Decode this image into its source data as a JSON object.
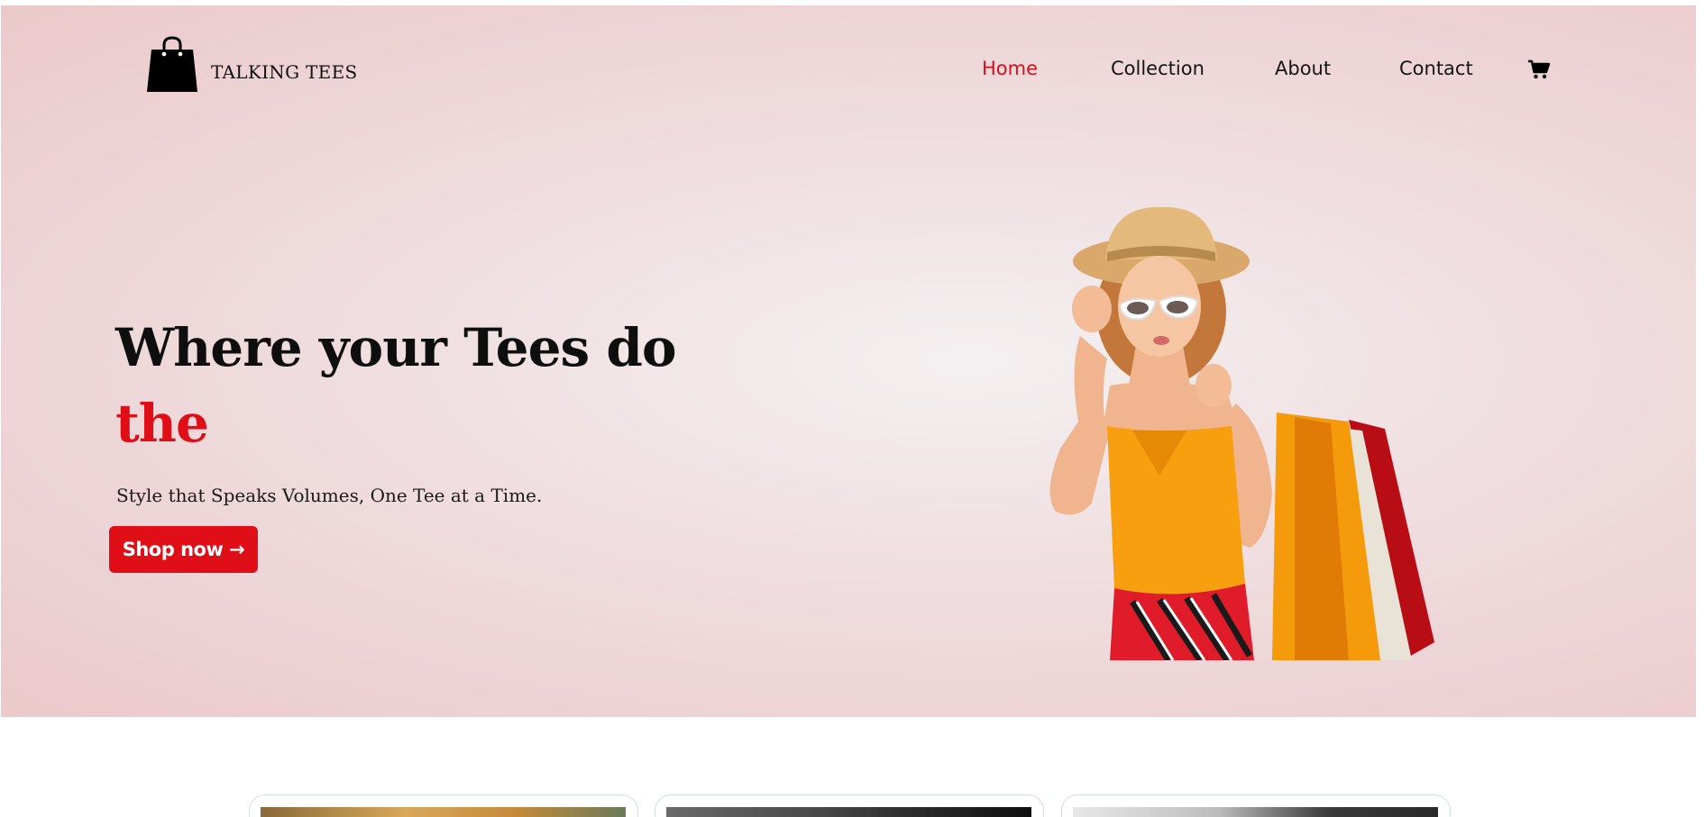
{
  "brand": {
    "name": "TALKING TEES",
    "logo_icon": "shopping-bag-icon"
  },
  "nav": {
    "items": [
      {
        "label": "Home",
        "active": true
      },
      {
        "label": "Collection",
        "active": false
      },
      {
        "label": "About",
        "active": false
      },
      {
        "label": "Contact",
        "active": false
      }
    ],
    "cart_icon": "cart-icon",
    "active_color": "#d0141a"
  },
  "hero": {
    "headline_line1": "Where your Tees do",
    "headline_line2": "the",
    "tagline": "Style that Speaks Volumes, One Tee at a Time.",
    "cta_label": "Shop now →",
    "accent_color": "#e00f17"
  },
  "collection_cards": [
    {
      "icon": "product-photo"
    },
    {
      "icon": "product-photo"
    },
    {
      "icon": "product-photo"
    }
  ]
}
